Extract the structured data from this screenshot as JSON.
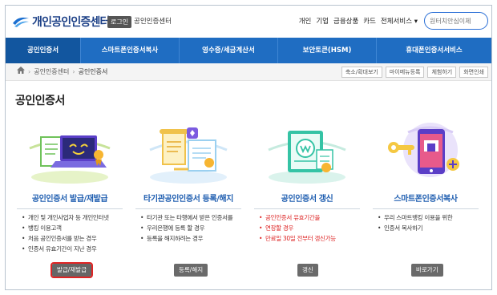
{
  "header": {
    "logo_text": "개인공인인증센터",
    "login_label": "로그인",
    "org_link": "공인인증센터",
    "top_menu": [
      "개인",
      "기업",
      "금융상품",
      "카드",
      "전체서비스 ▾"
    ],
    "search_placeholder": "원터치안심이체"
  },
  "nav": {
    "items": [
      "공인인증서",
      "스마트폰인증서복사",
      "영수증/세금계산서",
      "보안토큰(HSM)",
      "휴대폰인증서서비스"
    ],
    "active_index": 0
  },
  "breadcrumb": {
    "items": [
      "공인인증센터",
      "공인인증서"
    ]
  },
  "tools": [
    "축소/확대보기",
    "마이메뉴등록",
    "체험하기",
    "화면인쇄"
  ],
  "page_title": "공인인증서",
  "cards": [
    {
      "title": "공인인증서 발급/재발급",
      "bullets": [
        "개인 및 개인사업자 등 개인인터넷",
        "뱅킹 이용고객",
        "처음 공인인증서를 받는 경우",
        "인증서 유효기간이 지난 경우"
      ],
      "bullet_red": [
        false,
        false,
        false,
        false
      ],
      "button": "발급/재발급",
      "highlighted": true,
      "icon": "certificate-laptop-icon"
    },
    {
      "title": "타기관공인인증서 등록/해지",
      "bullets": [
        "타기관 또는 타행에서 받은 인증서를",
        "우리은행에 등록 할 경우",
        "등록을 해지하려는 경우"
      ],
      "bullet_red": [
        false,
        false,
        false
      ],
      "button": "등록/해지",
      "highlighted": false,
      "icon": "certificate-transfer-icon"
    },
    {
      "title": "공인인증서 갱신",
      "bullets": [
        "공인인증서 유효기간을",
        "연장할 경우",
        "만료일 30일 전부터 갱신가능"
      ],
      "bullet_red": [
        true,
        true,
        true
      ],
      "button": "갱신",
      "highlighted": false,
      "icon": "certificate-renew-icon"
    },
    {
      "title": "스마트폰인증서복사",
      "bullets": [
        "우리 스마트뱅킹 이용을 위한",
        "인증서 복사하기"
      ],
      "bullet_red": [
        false,
        false
      ],
      "button": "바로가기",
      "highlighted": false,
      "icon": "smartphone-copy-icon"
    }
  ],
  "colors": {
    "brand": "#1f6dc2",
    "nav_active": "#12569f",
    "title_blue": "#1f5eb0",
    "alert_red": "#dd2222"
  }
}
